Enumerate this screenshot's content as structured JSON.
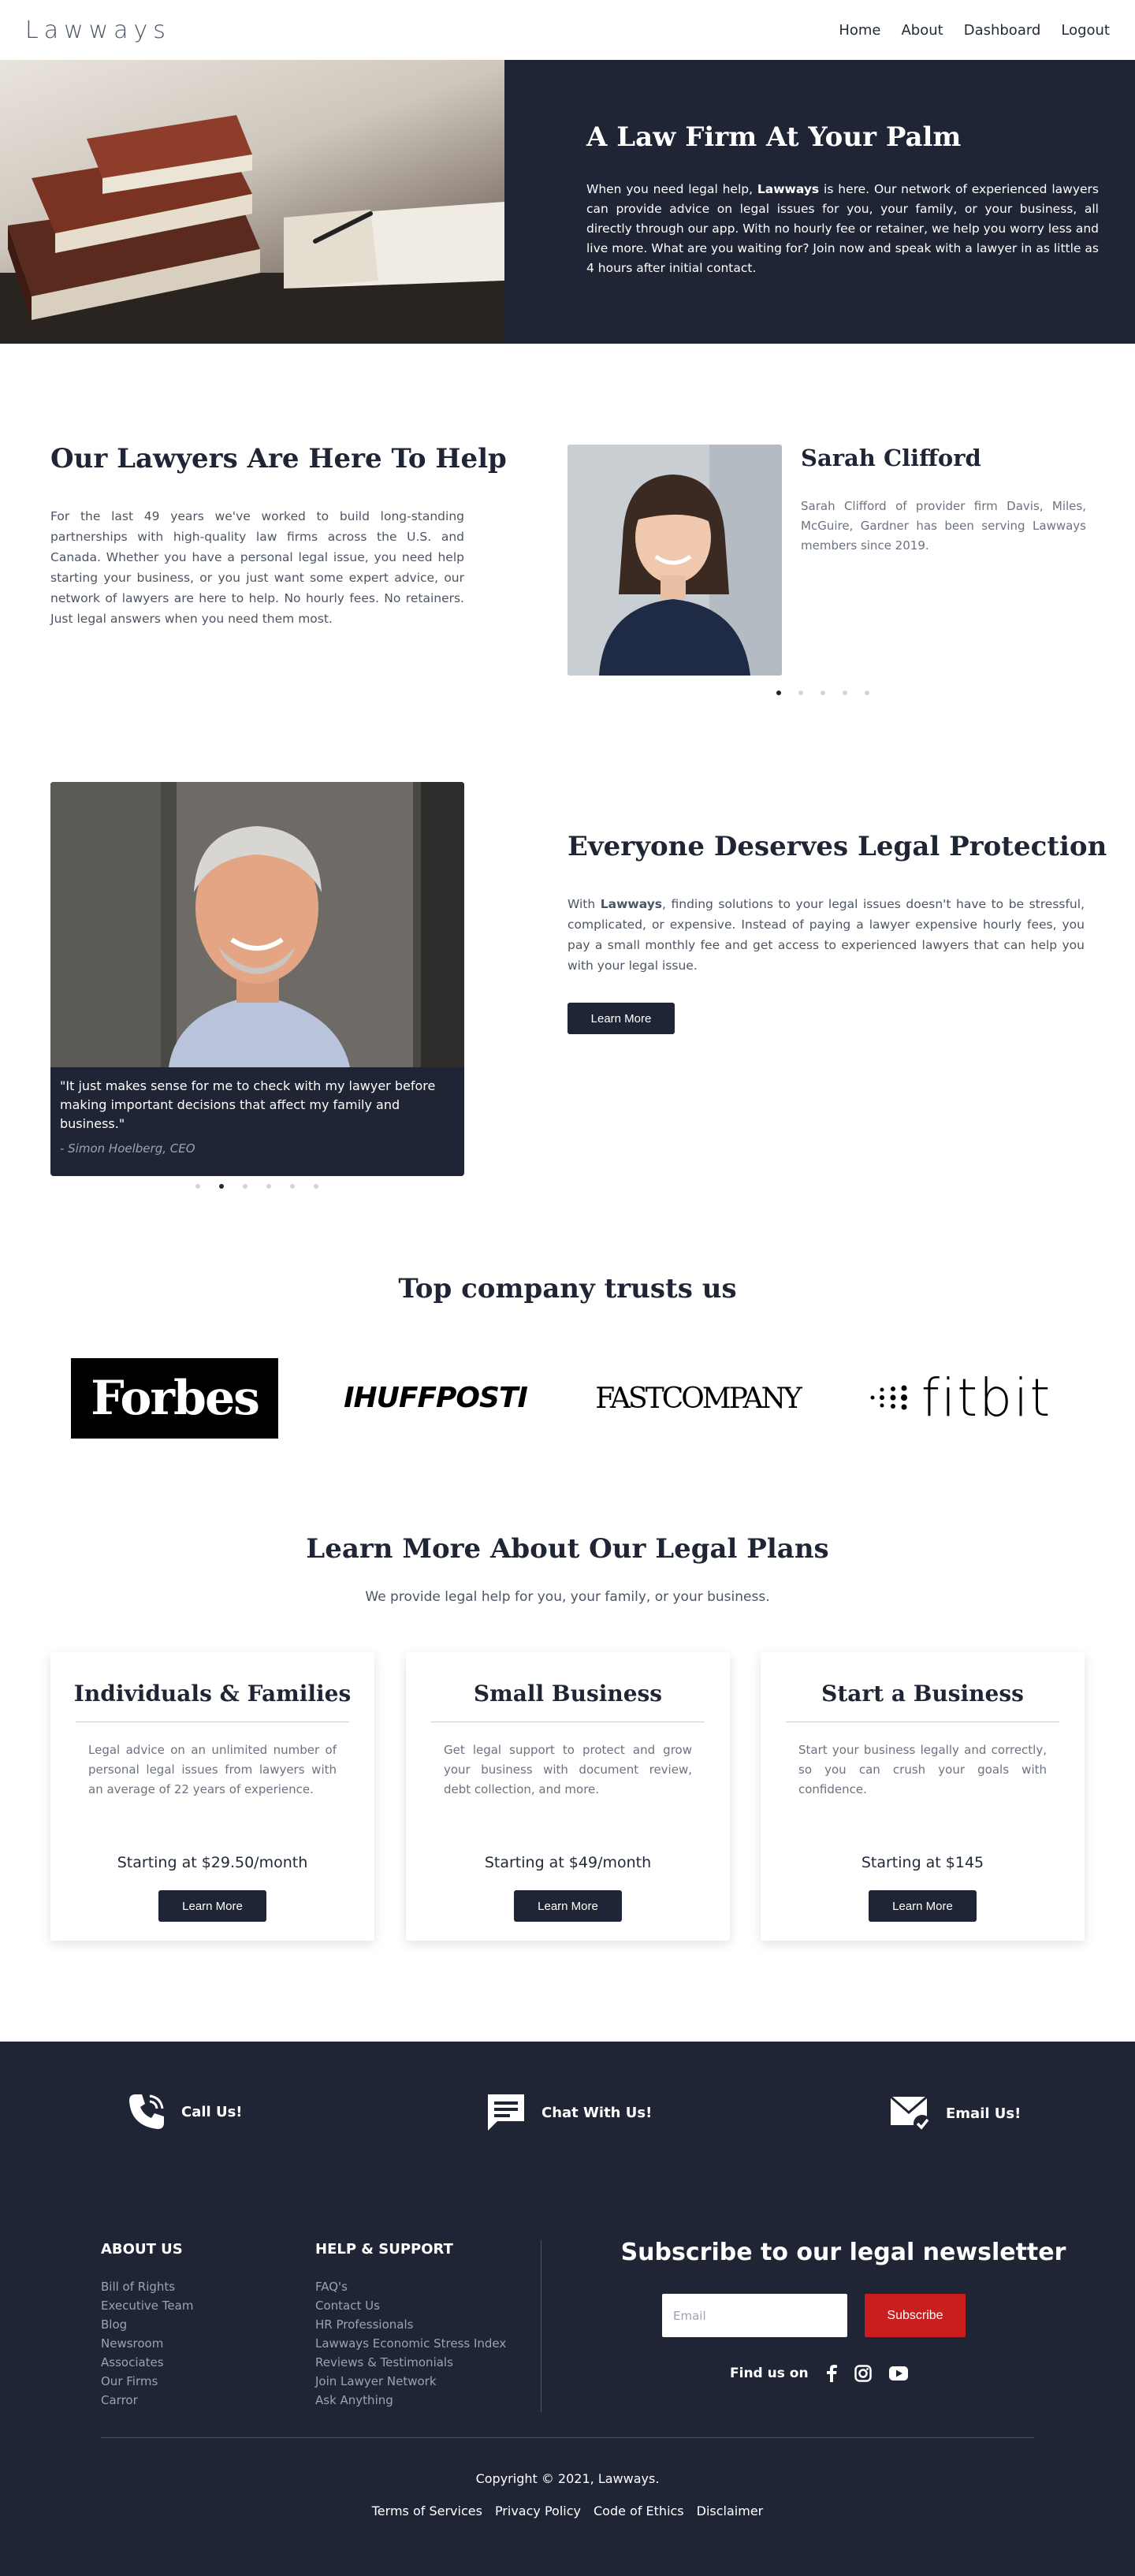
{
  "nav": {
    "logo": "Lawways",
    "links": [
      "Home",
      "About",
      "Dashboard",
      "Logout"
    ]
  },
  "hero": {
    "title": "A Law Firm At Your Palm",
    "text_before": "When you need legal help, ",
    "text_brand": "Lawways",
    "text_after": " is here. Our network of experienced lawyers can provide advice on legal issues for you, your family, or your business, all directly through our app. With no hourly fee or retainer, we help you worry less and live more. What are you waiting for? Join now and speak with a lawyer in as little as 4 hours after initial contact."
  },
  "lawyers": {
    "title": "Our Lawyers Are Here To Help",
    "text": "For the last 49 years we've worked to build long-standing partnerships with high-quality law firms across the U.S. and Canada. Whether you have a personal legal issue, you need help starting your business, or you just want some expert advice, our network of lawyers are here to help. No hourly fees. No retainers. Just legal answers when you need them most.",
    "featured": {
      "name": "Sarah Clifford",
      "bio": "Sarah Clifford of provider firm Davis, Miles, McGuire, Gardner has been serving Lawways members since 2019."
    },
    "carousel_count": 5,
    "carousel_active": 0
  },
  "protection": {
    "testimonial_quote": "\"It just makes sense for me to check with my lawyer before making important decisions that affect my family and business.\"",
    "testimonial_author": "- Simon Hoelberg, CEO",
    "carousel_count": 6,
    "carousel_active": 1,
    "title": "Everyone Deserves Legal Protection",
    "text_before": "With ",
    "text_brand": "Lawways",
    "text_after": ", finding solutions to your legal issues doesn't have to be stressful, complicated, or expensive. Instead of paying a lawyer expensive hourly fees, you pay a small monthly fee and get access to experienced lawyers that can help you with your legal issue.",
    "button": "Learn More"
  },
  "trust": {
    "title": "Top company trusts us",
    "brands": [
      "Forbes",
      "IHUFFPOSTI",
      "FASTCOMPANY",
      "fitbit"
    ]
  },
  "plans": {
    "title": "Learn More About Our Legal Plans",
    "subtitle": "We provide legal help for you, your family, or your business.",
    "items": [
      {
        "title": "Individuals & Families",
        "text": "Legal advice on an unlimited number of personal legal issues from lawyers with an average of 22 years of experience.",
        "price": "Starting at $29.50/month",
        "button": "Learn More"
      },
      {
        "title": "Small Business",
        "text": "Get legal support to protect and grow your business with document review, debt collection, and more.",
        "price": "Starting at $49/month",
        "button": "Learn More"
      },
      {
        "title": "Start a Business",
        "text": "Start your business legally and correctly, so you can crush your goals with confidence.",
        "price": "Starting at $145",
        "button": "Learn More"
      }
    ]
  },
  "footer": {
    "contacts": [
      "Call Us!",
      "Chat With Us!",
      "Email Us!"
    ],
    "about": {
      "heading": "ABOUT US",
      "links": [
        "Bill of Rights",
        "Executive Team",
        "Blog",
        "Newsroom",
        "Associates",
        "Our Firms",
        "Carror"
      ]
    },
    "help": {
      "heading": "HELP & SUPPORT",
      "links": [
        "FAQ's",
        "Contact Us",
        "HR Professionals",
        "Lawways Economic Stress Index",
        "Reviews & Testimonials",
        "Join Lawyer Network",
        "Ask Anything"
      ]
    },
    "newsletter": {
      "title": "Subscribe to our legal newsletter",
      "placeholder": "Email",
      "button": "Subscribe",
      "find_us": "Find us on"
    },
    "copyright": "Copyright © 2021, Lawways.",
    "legal_links": [
      "Terms of Services",
      "Privacy Policy",
      "Code of Ethics",
      "Disclaimer"
    ]
  },
  "colors": {
    "navy": "#1f2535",
    "accent_red": "#c81e1e",
    "muted_text": "#6b7280"
  }
}
